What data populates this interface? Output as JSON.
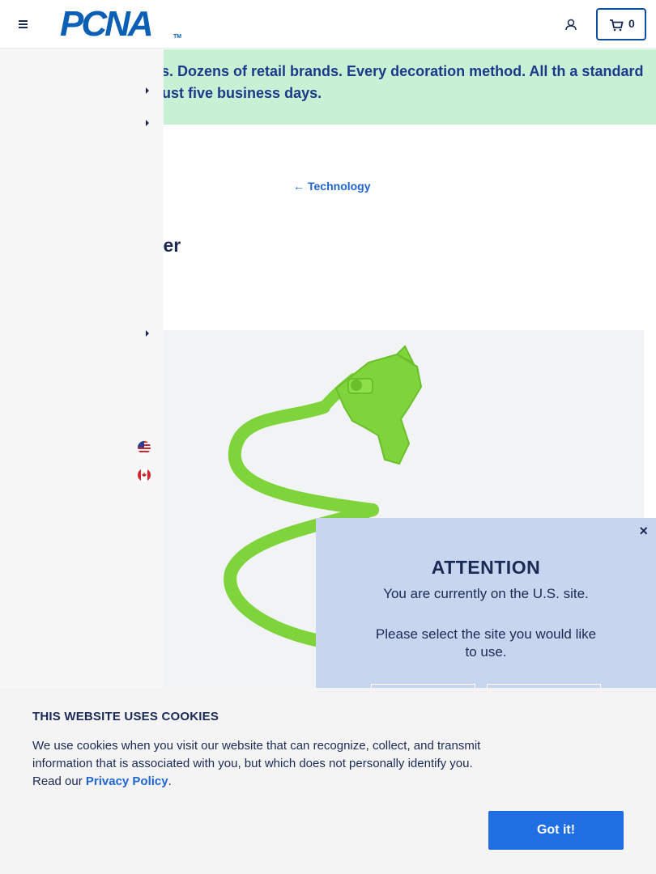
{
  "header": {
    "logo_text": "PCNA",
    "logo_tm": "TM",
    "cart_count": "0"
  },
  "banner": {
    "text": "ls of products. Dozens of retail brands. Every decoration method. All th a standard lead time of just five business days."
  },
  "breadcrumb": {
    "arrow": "←",
    "label": "Technology"
  },
  "product": {
    "title": "edia Holder",
    "image_color": "#7ed43a"
  },
  "modal": {
    "close": "×",
    "title": "ATTENTION",
    "line1": "You are currently on the U.S. site.",
    "line2": "Please select the site you would like to use."
  },
  "cookie": {
    "title": "THIS WEBSITE USES COOKIES",
    "text_before": "We use cookies when you visit our website that can recognize, collect, and transmit information that is associated with you, but which does not personally identify you. Read our ",
    "link": "Privacy Policy",
    "text_after": ".",
    "button": "Got it!"
  },
  "colors": {
    "brand_blue": "#0b5fb5",
    "banner_green": "#c7f0d5",
    "modal_bg": "#c7d6ee",
    "button_blue": "#1f6fe3",
    "link_blue": "#1f66d1"
  }
}
